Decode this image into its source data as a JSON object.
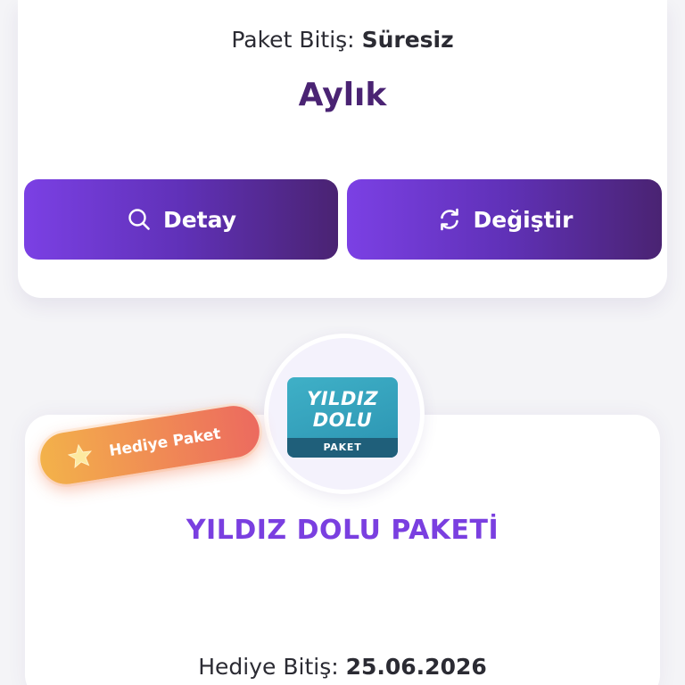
{
  "header": {
    "package_end_label": "Paket Bitiş:",
    "package_end_value": "Süresiz",
    "period": "Aylık"
  },
  "actions": {
    "detail_label": "Detay",
    "detail_icon": "search-icon",
    "change_label": "Değiştir",
    "change_icon": "refresh-icon"
  },
  "gift_package": {
    "badge_label": "Hediye Paket",
    "badge_icon": "star-icon",
    "logo_line1": "YILDIZ",
    "logo_line2": "DOLU",
    "logo_strip": "PAKET",
    "name": "YILDIZ DOLU PAKETİ",
    "end_label": "Hediye Bitiş:",
    "end_value": "25.06.2026"
  },
  "colors": {
    "primary_gradient_start": "#7b40e4",
    "primary_gradient_end": "#4a2372",
    "title_color": "#4a2373",
    "package_name_color": "#7a3fe0",
    "badge_gradient_start": "#f3b24a",
    "badge_gradient_end": "#ec6a5f",
    "logo_color": "#3fb0c7"
  }
}
